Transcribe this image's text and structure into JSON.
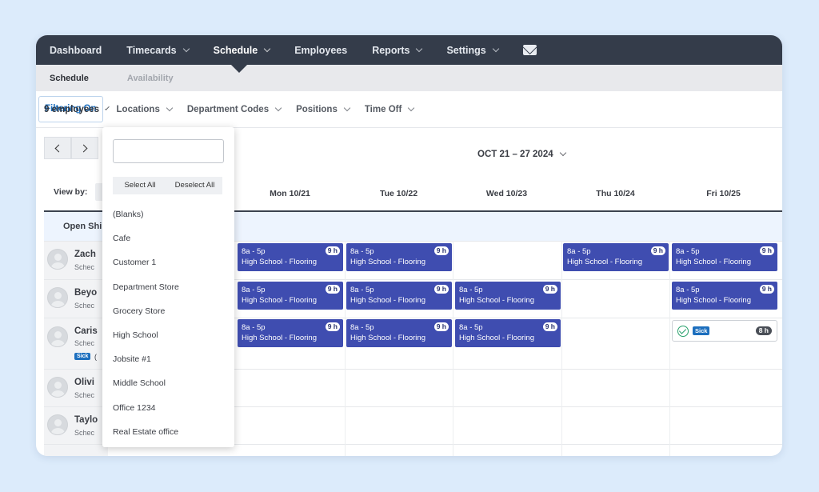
{
  "nav": {
    "items": [
      {
        "label": "Dashboard",
        "dropdown": false
      },
      {
        "label": "Timecards",
        "dropdown": true
      },
      {
        "label": "Schedule",
        "dropdown": true,
        "active": true
      },
      {
        "label": "Employees",
        "dropdown": false
      },
      {
        "label": "Reports",
        "dropdown": true
      },
      {
        "label": "Settings",
        "dropdown": true
      }
    ],
    "mail_icon": "mail-icon"
  },
  "subnav": {
    "schedule": "Schedule",
    "availability": "Availability"
  },
  "filters": {
    "filtering_on": "Filtering On",
    "locations": "Locations",
    "department_codes": "Department Codes",
    "positions": "Positions",
    "time_off": "Time Off",
    "employees": "9 employees"
  },
  "calendar": {
    "date_range": "OCT 21 – 27 2024",
    "view_by": "View by:",
    "days": [
      "Mon 10/21",
      "Tue 10/22",
      "Wed 10/23",
      "Thu 10/24",
      "Fri 10/25"
    ],
    "open_shifts": "Open Shi"
  },
  "employees": [
    {
      "name": "Zach",
      "sub": "Schec"
    },
    {
      "name": "Beyo",
      "sub": "Schec"
    },
    {
      "name": "Caris",
      "sub": "Schec",
      "sick": "Sick",
      "extra": "("
    },
    {
      "name": "Olivi",
      "sub": "Schec"
    },
    {
      "name": "Taylo",
      "sub": "Schec"
    }
  ],
  "shift_template": {
    "time": "8a - 5p",
    "location": "High School - Flooring",
    "hours": "9 h"
  },
  "sick_card": {
    "label": "Sick",
    "hours": "8 h"
  },
  "dropdown": {
    "select_all": "Select All",
    "deselect_all": "Deselect All",
    "search_value": "",
    "items": [
      "(Blanks)",
      "Cafe",
      "Customer 1",
      "Department Store",
      "Grocery Store",
      "High School",
      "Jobsite #1",
      "Middle School",
      "Office 1234",
      "Real Estate office"
    ]
  },
  "colors": {
    "nav_bg": "#343c4a",
    "shift_bg": "#3f4db0",
    "accent": "#1d6fbe",
    "page_bg": "#dcebfb"
  }
}
